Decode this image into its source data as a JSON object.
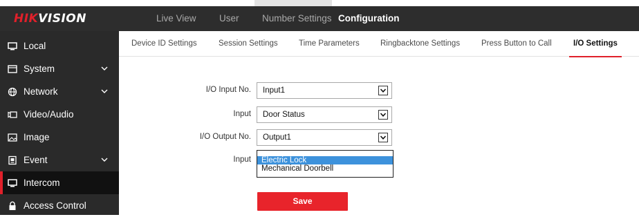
{
  "brand": {
    "logo_red": "HIK",
    "logo_white": "VISION"
  },
  "topnav": {
    "items": [
      {
        "label": "Live View"
      },
      {
        "label": "User"
      },
      {
        "label": "Number Settings"
      },
      {
        "label": "Configuration",
        "active": true
      }
    ]
  },
  "sidebar": {
    "items": [
      {
        "label": "Local",
        "icon": "monitor-icon"
      },
      {
        "label": "System",
        "icon": "system-icon",
        "expandable": true
      },
      {
        "label": "Network",
        "icon": "globe-icon",
        "expandable": true
      },
      {
        "label": "Video/Audio",
        "icon": "camera-icon"
      },
      {
        "label": "Image",
        "icon": "image-icon"
      },
      {
        "label": "Event",
        "icon": "event-icon",
        "expandable": true
      },
      {
        "label": "Intercom",
        "icon": "intercom-icon",
        "active": true
      },
      {
        "label": "Access Control",
        "icon": "lock-icon"
      }
    ]
  },
  "subtabs": {
    "items": [
      {
        "label": "Device ID Settings"
      },
      {
        "label": "Session Settings"
      },
      {
        "label": "Time Parameters"
      },
      {
        "label": "Ringbacktone Settings"
      },
      {
        "label": "Press Button to Call"
      },
      {
        "label": "I/O Settings",
        "active": true
      }
    ]
  },
  "form": {
    "io_input_no": {
      "label": "I/O Input No.",
      "value": "Input1"
    },
    "input": {
      "label": "Input",
      "value": "Door Status"
    },
    "io_output_no": {
      "label": "I/O Output No.",
      "value": "Output1"
    },
    "output_input": {
      "label": "Input",
      "options": [
        "Electric Lock",
        "Mechanical Doorbell"
      ],
      "highlighted": "Electric Lock"
    },
    "save_label": "Save"
  },
  "colors": {
    "accent_red": "#e0202a",
    "topbar": "#2d2d2d",
    "sidebar": "#2a2a2a",
    "dropdown_highlight": "#3d92dc"
  }
}
